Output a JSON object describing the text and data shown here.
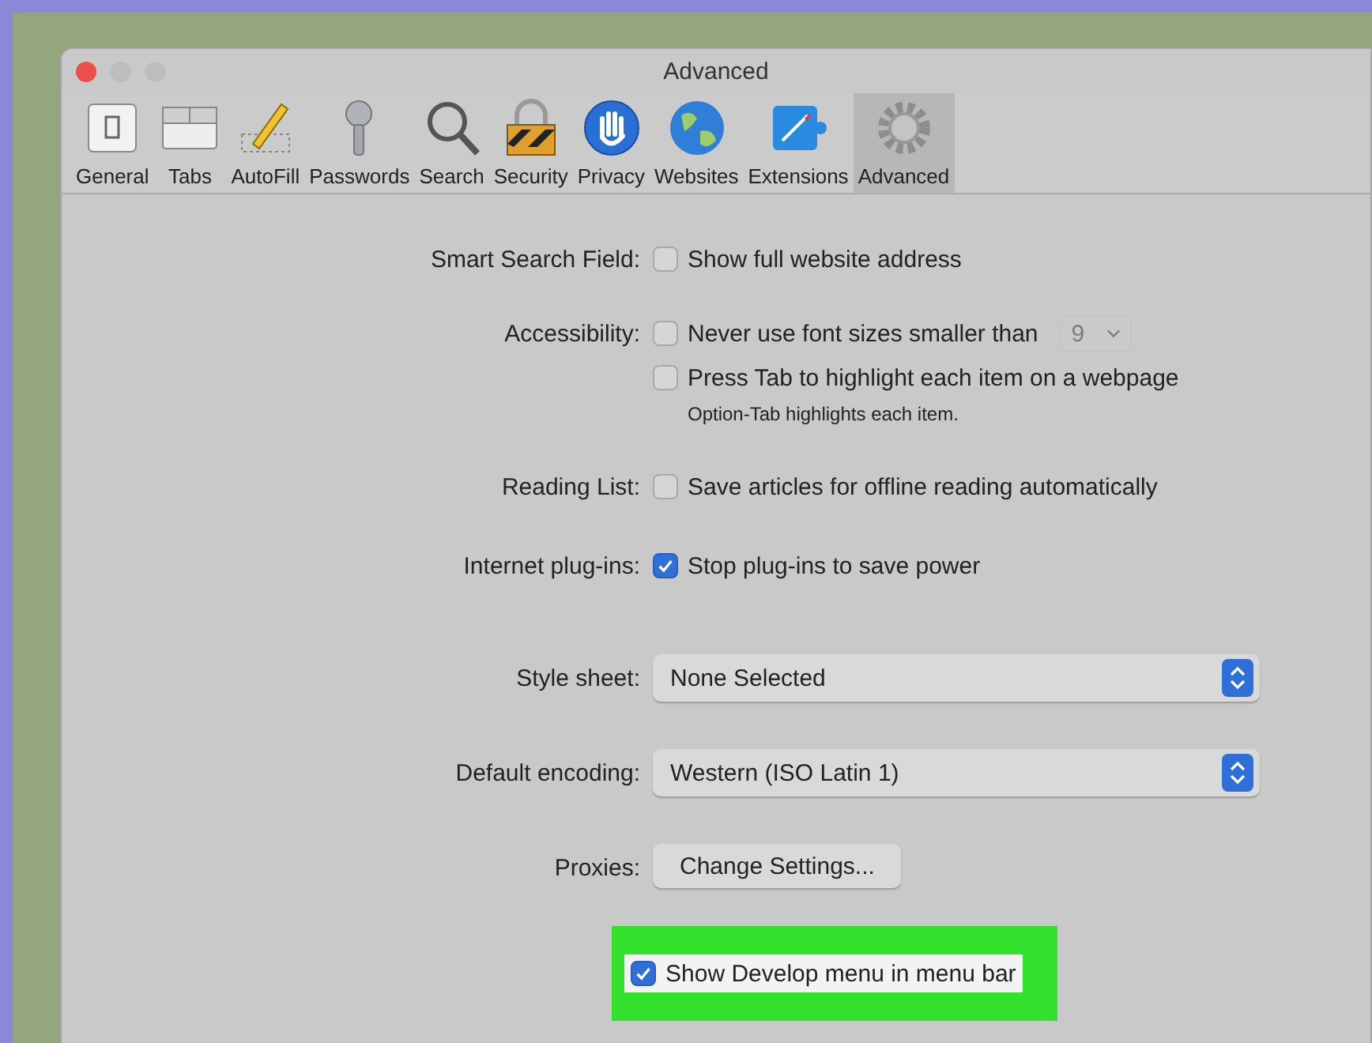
{
  "window": {
    "title": "Advanced"
  },
  "toolbar": [
    {
      "label": "General",
      "selected": false
    },
    {
      "label": "Tabs",
      "selected": false
    },
    {
      "label": "AutoFill",
      "selected": false
    },
    {
      "label": "Passwords",
      "selected": false
    },
    {
      "label": "Search",
      "selected": false
    },
    {
      "label": "Security",
      "selected": false
    },
    {
      "label": "Privacy",
      "selected": false
    },
    {
      "label": "Websites",
      "selected": false
    },
    {
      "label": "Extensions",
      "selected": false
    },
    {
      "label": "Advanced",
      "selected": true
    }
  ],
  "sections": [
    {
      "label": "Smart Search Field:",
      "items": [
        {
          "kind": "checkbox",
          "label": "Show full website address",
          "checked": false
        }
      ]
    },
    {
      "label": "Accessibility:",
      "items": [
        {
          "kind": "checkbox",
          "label": "Never use font sizes smaller than",
          "checked": false,
          "popup": {
            "value": "9",
            "disabled": true
          }
        },
        {
          "kind": "checkbox",
          "label": "Press Tab to highlight each item on a webpage",
          "checked": false
        },
        {
          "kind": "note",
          "label": "Option-Tab highlights each item."
        }
      ]
    },
    {
      "label": "Reading List:",
      "items": [
        {
          "kind": "checkbox",
          "label": "Save articles for offline reading automatically",
          "checked": false
        }
      ]
    },
    {
      "label": "Internet plug-ins:",
      "items": [
        {
          "kind": "checkbox",
          "label": "Stop plug-ins to save power",
          "checked": true
        }
      ]
    },
    {
      "label": "Style sheet:",
      "items": [
        {
          "kind": "select",
          "label": "None Selected"
        }
      ]
    },
    {
      "label": "Default encoding:",
      "items": [
        {
          "kind": "select",
          "label": "Western (ISO Latin 1)"
        }
      ]
    },
    {
      "label": "Proxies:",
      "items": [
        {
          "kind": "button",
          "label": "Change Settings..."
        }
      ]
    },
    {
      "items": [
        {
          "kind": "checkbox",
          "label": "Show Develop menu in menu bar",
          "checked": true,
          "highlighted": true
        }
      ]
    }
  ]
}
